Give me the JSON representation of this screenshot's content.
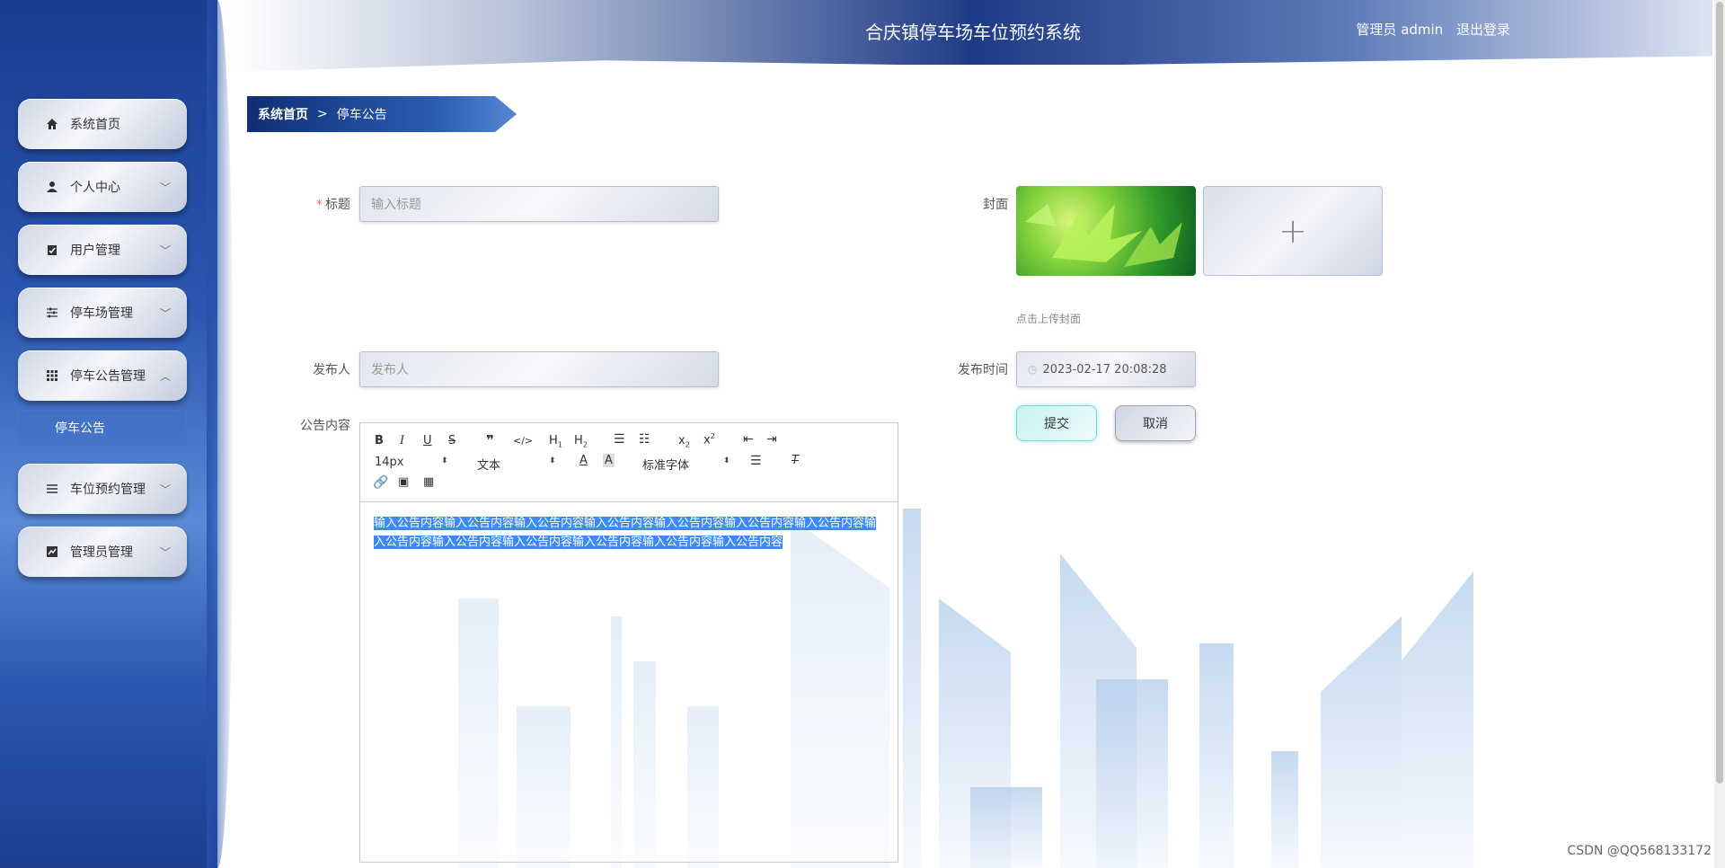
{
  "header": {
    "title": "合庆镇停车场车位预约系统",
    "role": "管理员 admin",
    "logout": "退出登录"
  },
  "sidebar": {
    "items": [
      {
        "label": "系统首页",
        "icon": "home-icon"
      },
      {
        "label": "个人中心",
        "icon": "user-icon"
      },
      {
        "label": "用户管理",
        "icon": "clipboard-icon"
      },
      {
        "label": "停车场管理",
        "icon": "sliders-icon"
      },
      {
        "label": "停车公告管理",
        "icon": "grid-icon"
      },
      {
        "label": "车位预约管理",
        "icon": "list-icon"
      },
      {
        "label": "管理员管理",
        "icon": "chart-icon"
      }
    ],
    "sub_item": "停车公告"
  },
  "breadcrumb": {
    "home": "系统首页",
    "sep": ">",
    "current": "停车公告"
  },
  "form": {
    "title_label": "标题",
    "title_placeholder": "输入标题",
    "cover_label": "封面",
    "cover_hint": "点击上传封面",
    "publisher_label": "发布人",
    "publisher_placeholder": "发布人",
    "time_label": "发布时间",
    "time_value": "2023-02-17 20:08:28",
    "content_label": "公告内容",
    "submit": "提交",
    "cancel": "取消"
  },
  "editor": {
    "font_size": "14px",
    "text_type": "文本",
    "font_family": "标准字体",
    "content": "输入公告内容输入公告内容输入公告内容输入公告内容输入公告内容输入公告内容输入公告内容输入公告内容输入公告内容输入公告内容输入公告内容输入公告内容输入公告内容"
  },
  "watermark": "CSDN @QQ568133172"
}
